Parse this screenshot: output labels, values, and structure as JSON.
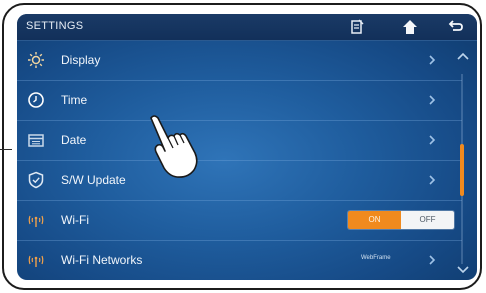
{
  "header": {
    "title": "SETTINGS",
    "icons": [
      "memo-icon",
      "home-icon",
      "back-icon"
    ]
  },
  "menu": {
    "items": [
      {
        "label": "Display",
        "icon": "sun-icon"
      },
      {
        "label": "Time",
        "icon": "clock-icon"
      },
      {
        "label": "Date",
        "icon": "calendar-icon"
      },
      {
        "label": "S/W Update",
        "icon": "shield-icon"
      },
      {
        "label": "Wi-Fi",
        "icon": "wifi-icon"
      },
      {
        "label": "Wi-Fi Networks",
        "icon": "wifi-icon",
        "value": "WebFrame"
      }
    ]
  },
  "wifi_toggle": {
    "on_label": "ON",
    "off_label": "OFF",
    "state": "on"
  },
  "colors": {
    "accent": "#f08a1e",
    "background": "#1f5d9e",
    "topbar": "#12305a"
  }
}
